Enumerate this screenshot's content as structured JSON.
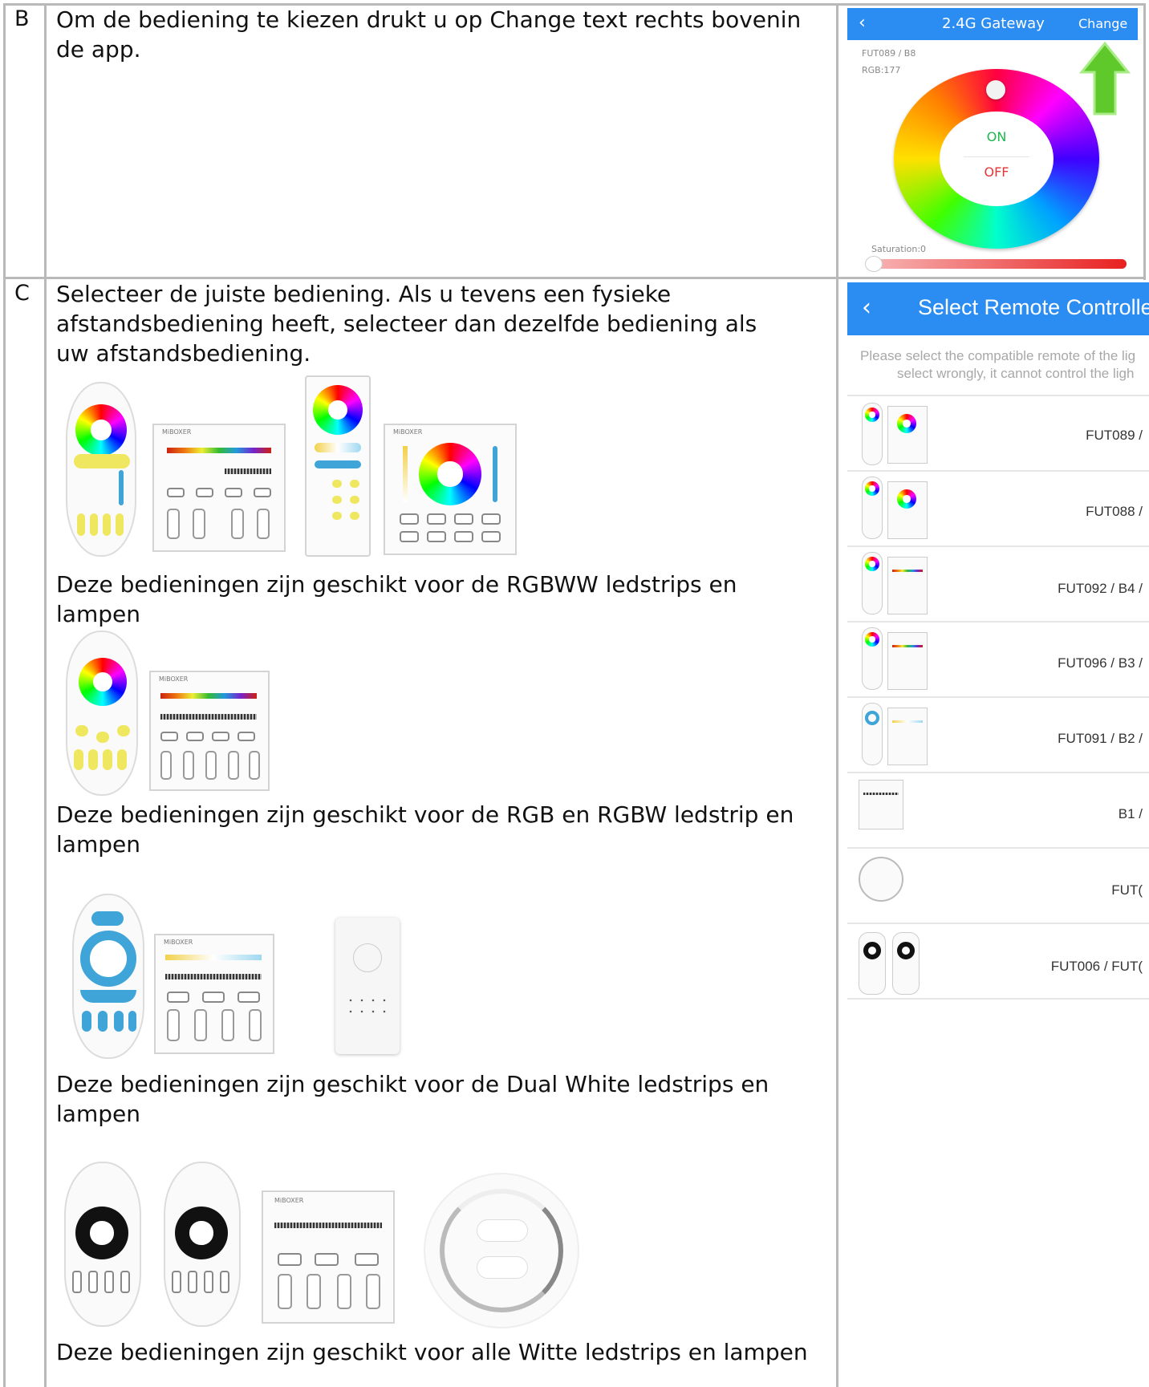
{
  "rows": [
    {
      "letter": "B",
      "text": "Om de bediening te kiezen drukt u op Change text rechts bovenin de app."
    },
    {
      "letter": "C",
      "text": "Selecteer de juiste bediening. Als u tevens een fysieke afstandsbediening heeft, selecteer dan dezelfde bediening als uw afstandsbediening."
    }
  ],
  "groups": [
    {
      "caption": "Deze bedieningen zijn geschikt voor de RGBWW ledstrips en lampen"
    },
    {
      "caption": "Deze bedieningen zijn geschikt voor de RGB en RGBW ledstrip en lampen"
    },
    {
      "caption": "Deze bedieningen zijn geschikt voor de Dual White ledstrips en lampen"
    },
    {
      "caption": "Deze bedieningen zijn geschikt voor alle Witte ledstrips en lampen"
    }
  ],
  "app1": {
    "back": "‹",
    "title": "2.4G Gateway",
    "change": "Change",
    "model": "FUT089 / B8",
    "rgb": "RGB:177",
    "on": "ON",
    "off": "OFF",
    "saturation": "Saturation:0",
    "saturation_value": 0,
    "arrow_color": "#5fc82a",
    "accent": "#2b8cf2"
  },
  "app2": {
    "back": "‹",
    "title": "Select Remote Controller",
    "hint_line1": "Please select the compatible remote of the lig",
    "hint_line2": "select wrongly, it cannot control the ligh",
    "items": [
      "FUT089 /",
      "FUT088 /",
      "FUT092 / B4 /",
      "FUT096 / B3 /",
      "FUT091 / B2 /",
      "B1 /",
      "FUT(",
      "FUT006 / FUT("
    ]
  },
  "brand_mark": "MiBOXER"
}
